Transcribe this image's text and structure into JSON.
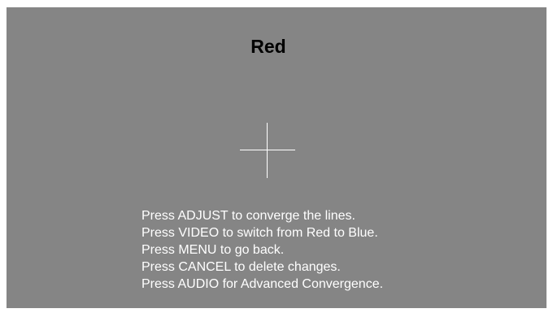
{
  "title": "Red",
  "colors": {
    "background": "#858585",
    "crosshair": "#ffffff",
    "title_text": "#000000",
    "instruction_text": "#ffffff"
  },
  "crosshair_icon": "crosshair-icon",
  "instructions": [
    "Press ADJUST to converge the lines.",
    "Press VIDEO to switch from Red to Blue.",
    "Press MENU to go back.",
    "Press CANCEL to delete changes.",
    "Press AUDIO for Advanced Convergence."
  ]
}
